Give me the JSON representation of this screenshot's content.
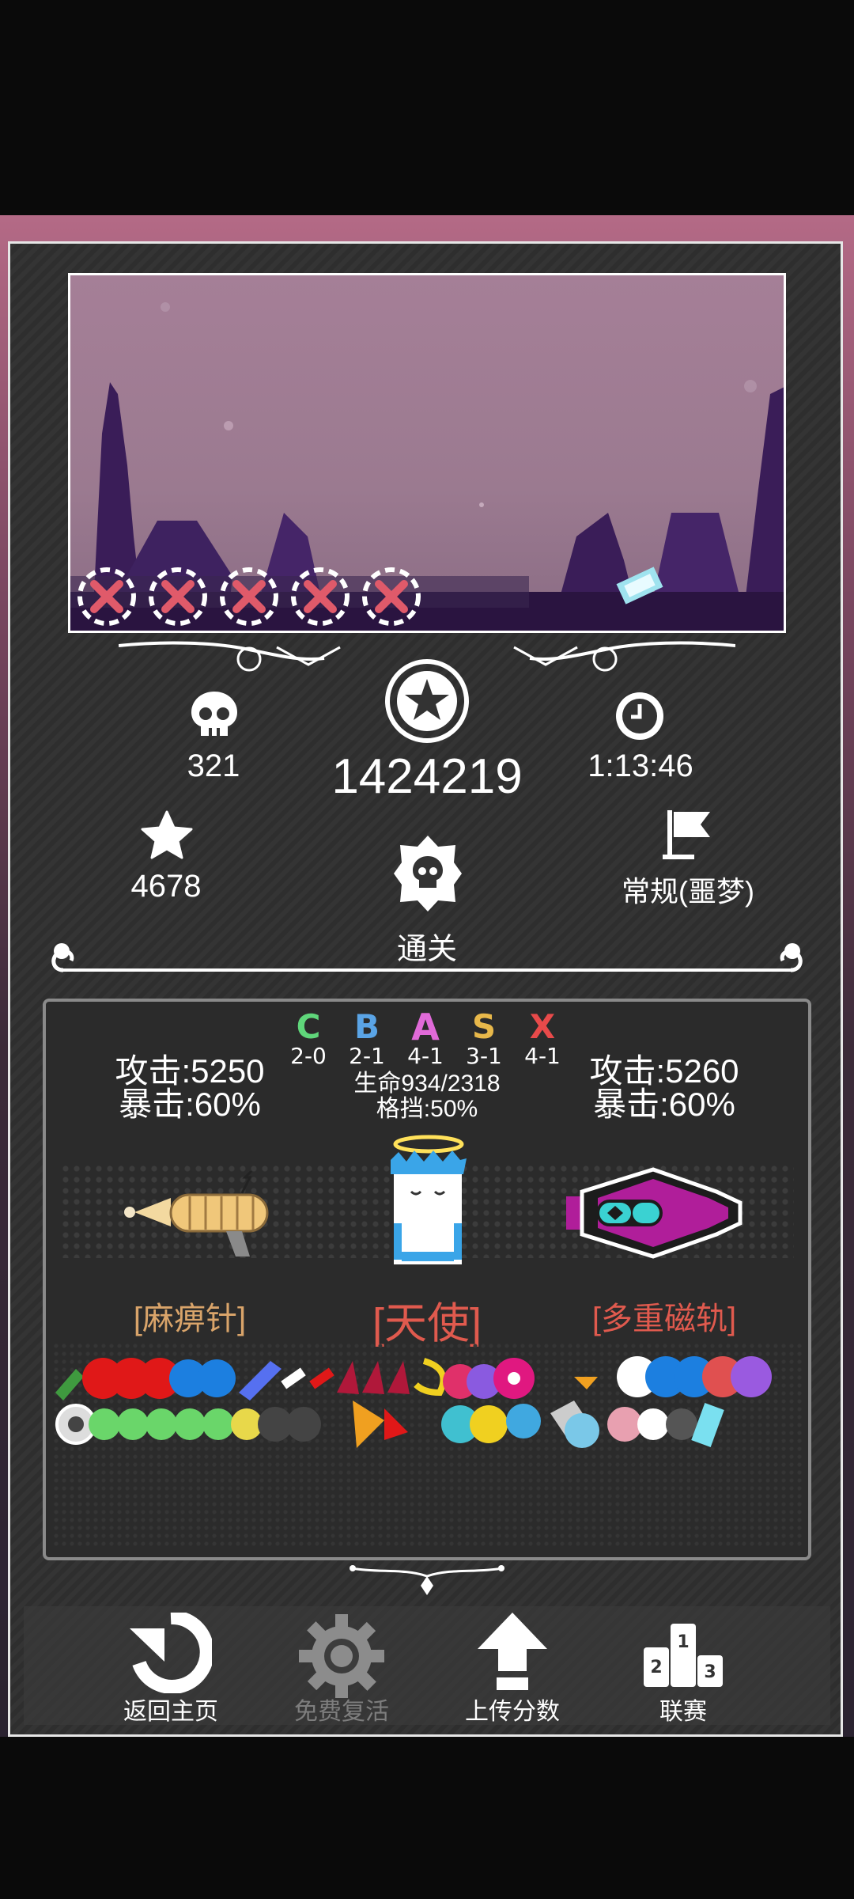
{
  "stats": {
    "deaths": "321",
    "score": "1424219",
    "time": "1:13:46",
    "stars": "4678",
    "mode": "常规(噩梦)",
    "result": "通关"
  },
  "grades": [
    {
      "letter": "C",
      "value": "2-0",
      "color": "#5fd67a"
    },
    {
      "letter": "B",
      "value": "2-1",
      "color": "#5aa4e6"
    },
    {
      "letter": "A",
      "value": "4-1",
      "color": "#e06ad8"
    },
    {
      "letter": "S",
      "value": "3-1",
      "color": "#e8b84a"
    },
    {
      "letter": "X",
      "value": "4-1",
      "color": "#e84a4a"
    }
  ],
  "character": {
    "hp": "生命934/2318",
    "block": "格挡:50%",
    "name": "[天使]"
  },
  "left_weapon": {
    "attack": "攻击:5250",
    "crit": "暴击:60%",
    "name": "[麻痹针]"
  },
  "right_weapon": {
    "attack": "攻击:5260",
    "crit": "暴击:60%",
    "name": "[多重磁轨]"
  },
  "buttons": {
    "home": "返回主页",
    "revive": "免费复活",
    "upload": "上传分数",
    "league": "联赛"
  },
  "colors": {
    "accent_red": "#e05a4e",
    "weapon_left_label": "#d9a46a",
    "panel_border": "#e6e6e6"
  }
}
